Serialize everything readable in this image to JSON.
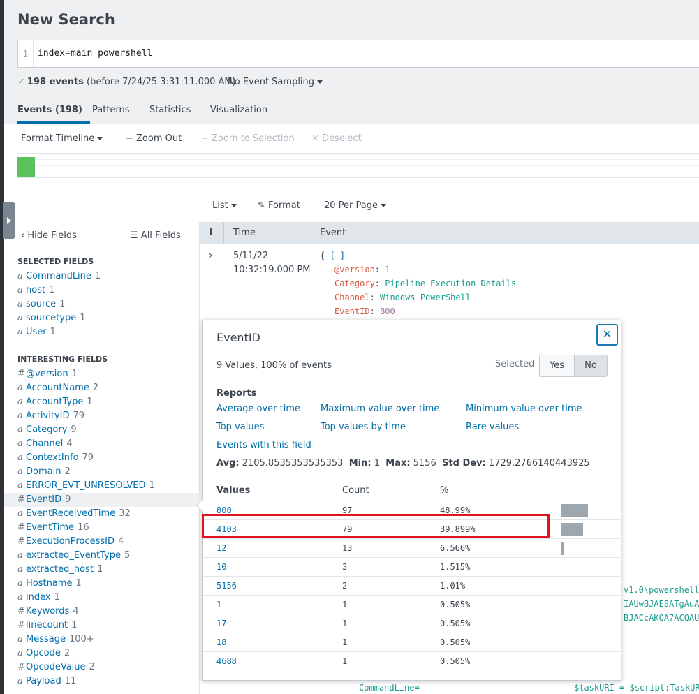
{
  "page": {
    "title": "New Search",
    "search": {
      "line_number": "1",
      "query": "index=main powershell"
    },
    "status": {
      "count": "198 events",
      "detail": "(before 7/24/25 3:31:11.000 AM)",
      "sampling": "No Event Sampling"
    }
  },
  "tabs": [
    "Events (198)",
    "Patterns",
    "Statistics",
    "Visualization"
  ],
  "timeline_controls": {
    "format": "Format Timeline",
    "zoom_out": "Zoom Out",
    "zoom_selection": "Zoom to Selection",
    "deselect": "Deselect"
  },
  "colors": {
    "accent": "#006eaa",
    "timeline_bar": "#5cc05c",
    "highlight": "#e0141e"
  },
  "list_controls": {
    "list": "List",
    "format": "Format",
    "per_page": "20 Per Page"
  },
  "fields": {
    "hide": "Hide Fields",
    "all": "All Fields",
    "selected_header": "SELECTED FIELDS",
    "interesting_header": "INTERESTING FIELDS",
    "selected": [
      {
        "type": "a",
        "name": "CommandLine",
        "count": "1"
      },
      {
        "type": "a",
        "name": "host",
        "count": "1"
      },
      {
        "type": "a",
        "name": "source",
        "count": "1"
      },
      {
        "type": "a",
        "name": "sourcetype",
        "count": "1"
      },
      {
        "type": "a",
        "name": "User",
        "count": "1"
      }
    ],
    "interesting": [
      {
        "type": "#",
        "name": "@version",
        "count": "1"
      },
      {
        "type": "a",
        "name": "AccountName",
        "count": "2"
      },
      {
        "type": "a",
        "name": "AccountType",
        "count": "1"
      },
      {
        "type": "a",
        "name": "ActivityID",
        "count": "79"
      },
      {
        "type": "a",
        "name": "Category",
        "count": "9"
      },
      {
        "type": "a",
        "name": "Channel",
        "count": "4"
      },
      {
        "type": "a",
        "name": "ContextInfo",
        "count": "79"
      },
      {
        "type": "a",
        "name": "Domain",
        "count": "2"
      },
      {
        "type": "a",
        "name": "ERROR_EVT_UNRESOLVED",
        "count": "1"
      },
      {
        "type": "#",
        "name": "EventID",
        "count": "9"
      },
      {
        "type": "a",
        "name": "EventReceivedTime",
        "count": "32"
      },
      {
        "type": "#",
        "name": "EventTime",
        "count": "16"
      },
      {
        "type": "#",
        "name": "ExecutionProcessID",
        "count": "4"
      },
      {
        "type": "a",
        "name": "extracted_EventType",
        "count": "5"
      },
      {
        "type": "a",
        "name": "extracted_host",
        "count": "1"
      },
      {
        "type": "a",
        "name": "Hostname",
        "count": "1"
      },
      {
        "type": "a",
        "name": "index",
        "count": "1"
      },
      {
        "type": "#",
        "name": "Keywords",
        "count": "4"
      },
      {
        "type": "#",
        "name": "linecount",
        "count": "1"
      },
      {
        "type": "a",
        "name": "Message",
        "count": "100+"
      },
      {
        "type": "a",
        "name": "Opcode",
        "count": "2"
      },
      {
        "type": "#",
        "name": "OpcodeValue",
        "count": "2"
      },
      {
        "type": "a",
        "name": "Payload",
        "count": "11"
      }
    ]
  },
  "table": {
    "col_i": "i",
    "col_time": "Time",
    "col_event": "Event"
  },
  "event": {
    "date": "5/11/22",
    "time": "10:32:19.000 PM",
    "brace": "{",
    "collapse": "[-]",
    "rows": [
      {
        "key": "@version",
        "value": "1",
        "kind": "num"
      },
      {
        "key": "Category",
        "value": "Pipeline Execution Details",
        "kind": "str"
      },
      {
        "key": "Channel",
        "value": "Windows PowerShell",
        "kind": "str"
      },
      {
        "key": "EventID",
        "value": "800",
        "kind": "num"
      }
    ],
    "fragments": [
      "v1.0\\powershell.",
      "IAUwBJAE8ATgAuAE",
      "BJACcAKQA7ACQAUg"
    ],
    "cmd_key": "CommandLine=",
    "cmd_val": "$taskURI = $script:TaskURI"
  },
  "popup": {
    "title": "EventID",
    "close": "✕",
    "summary": "9 Values, 100% of events",
    "selected_label": "Selected",
    "yes": "Yes",
    "no": "No",
    "reports_label": "Reports",
    "reports": [
      "Average over time",
      "Maximum value over time",
      "Minimum value over time",
      "Top values",
      "Top values by time",
      "Rare values",
      "Events with this field"
    ],
    "stats": {
      "avg_label": "Avg:",
      "avg": "2105.8535353535353",
      "min_label": "Min:",
      "min": "1",
      "max_label": "Max:",
      "max": "5156",
      "std_label": "Std Dev:",
      "std": "1729.2766140443925"
    },
    "headers": {
      "values": "Values",
      "count": "Count",
      "pct": "%"
    },
    "values": [
      {
        "value": "800",
        "count": "97",
        "pct": "48.99%",
        "frac": 0.4899
      },
      {
        "value": "4103",
        "count": "79",
        "pct": "39.899%",
        "frac": 0.39899
      },
      {
        "value": "12",
        "count": "13",
        "pct": "6.566%",
        "frac": 0.06566
      },
      {
        "value": "10",
        "count": "3",
        "pct": "1.515%",
        "frac": 0.01515
      },
      {
        "value": "5156",
        "count": "2",
        "pct": "1.01%",
        "frac": 0.0101
      },
      {
        "value": "1",
        "count": "1",
        "pct": "0.505%",
        "frac": 0.00505
      },
      {
        "value": "17",
        "count": "1",
        "pct": "0.505%",
        "frac": 0.00505
      },
      {
        "value": "18",
        "count": "1",
        "pct": "0.505%",
        "frac": 0.00505
      },
      {
        "value": "4688",
        "count": "1",
        "pct": "0.505%",
        "frac": 0.00505
      }
    ]
  }
}
